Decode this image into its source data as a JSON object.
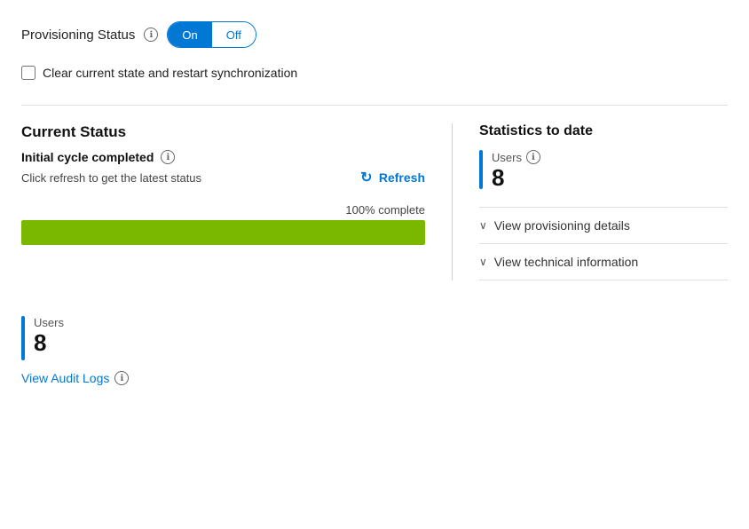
{
  "header": {
    "provisioning_label": "Provisioning Status",
    "toggle_on": "On",
    "toggle_off": "Off",
    "info_icon_label": "ℹ"
  },
  "checkbox": {
    "label": "Clear current state and restart synchronization",
    "checked": false
  },
  "current_status": {
    "section_title": "Current Status",
    "status_label": "Initial cycle completed",
    "refresh_text": "Click refresh to get the latest status",
    "refresh_button": "Refresh",
    "progress_pct": "100% complete",
    "progress_value": 100
  },
  "right_panel": {
    "stats_title": "Statistics to date",
    "users_label": "Users",
    "users_count": "8",
    "expandable_items": [
      {
        "label": "View provisioning details"
      },
      {
        "label": "View technical information"
      }
    ]
  },
  "bottom_section": {
    "users_label": "Users",
    "users_count": "8",
    "audit_link": "View Audit Logs"
  },
  "icons": {
    "info": "ℹ",
    "chevron_down": "∨",
    "refresh": "↻"
  }
}
